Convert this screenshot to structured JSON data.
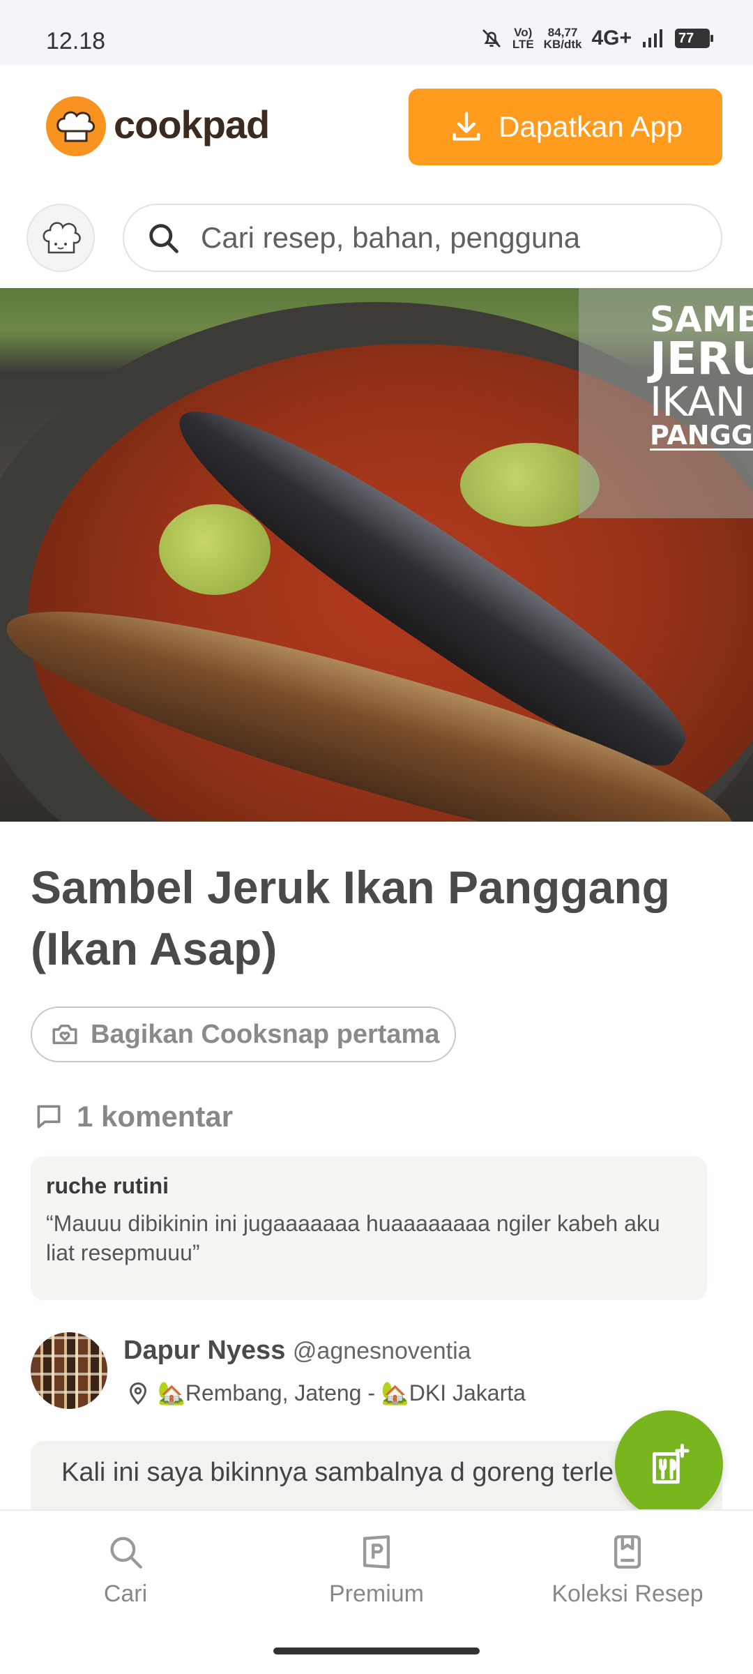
{
  "status_bar": {
    "time": "12.18",
    "volte_line1": "Vo)",
    "volte_line2": "LTE",
    "speed_value": "84,77",
    "speed_unit": "KB/dtk",
    "network": "4G+",
    "battery": "77"
  },
  "header": {
    "logo_text": "cookpad",
    "get_app_label": "Dapatkan App"
  },
  "search": {
    "placeholder": "Cari resep, bahan, pengguna"
  },
  "hero": {
    "overlay_lines": [
      "SAMBA",
      "JERUK",
      "IKAN",
      "PANGGAN"
    ]
  },
  "recipe": {
    "title": "Sambel Jeruk Ikan Panggang (Ikan Asap)",
    "cooksnap_label": "Bagikan Cooksnap pertama"
  },
  "comments": {
    "count_label": "1 komentar",
    "items": [
      {
        "author": "ruche rutini",
        "text": "“Mauuu dibikinin ini jugaaaaaaa huaaaaaaaa ngiler kabeh aku liat resepmuuu”"
      }
    ]
  },
  "author": {
    "name": "Dapur Nyess",
    "handle": "@agnesnoventia",
    "location": "🏡Rembang, Jateng - 🏡DKI Jakarta"
  },
  "story": {
    "text": "Kali ini saya bikinnya sambalnya d goreng terle"
  },
  "bottom_nav": [
    {
      "label": "Cari",
      "icon": "search-icon"
    },
    {
      "label": "Premium",
      "icon": "premium-icon"
    },
    {
      "label": "Koleksi Resep",
      "icon": "collection-icon"
    }
  ],
  "colors": {
    "brand_orange": "#ff9c1e",
    "fab_green": "#79b51d"
  }
}
